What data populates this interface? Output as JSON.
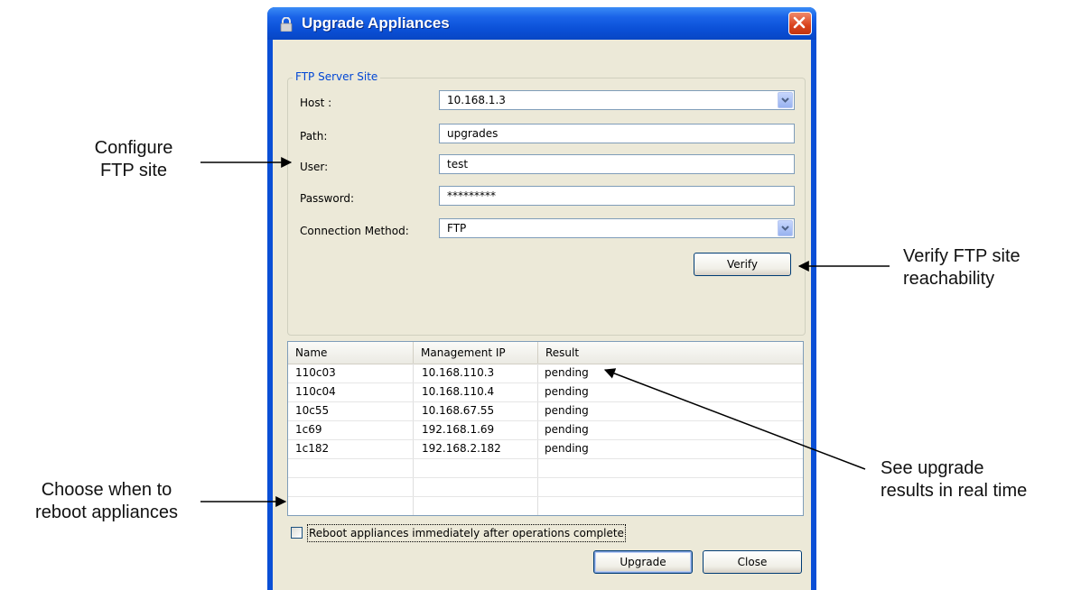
{
  "annotations": {
    "configure": [
      "Configure",
      "FTP site"
    ],
    "verify": [
      "Verify FTP site",
      "reachability"
    ],
    "results": [
      "See upgrade",
      "results in real time"
    ],
    "reboot": [
      "Choose when to",
      "reboot appliances"
    ]
  },
  "dialog": {
    "title": "Upgrade Appliances",
    "group_title": "FTP Server Site",
    "fields": {
      "host_label": "Host :",
      "host_value": "10.168.1.3",
      "path_label": "Path:",
      "path_value": "upgrades",
      "user_label": "User:",
      "user_value": "test",
      "password_label": "Password:",
      "password_value": "*********",
      "method_label": "Connection Method:",
      "method_value": "FTP"
    },
    "verify_button": "Verify",
    "table": {
      "columns": [
        "Name",
        "Management IP",
        "Result"
      ],
      "rows": [
        [
          "110c03",
          "10.168.110.3",
          "pending"
        ],
        [
          "110c04",
          "10.168.110.4",
          "pending"
        ],
        [
          "10c55",
          "10.168.67.55",
          "pending"
        ],
        [
          "1c69",
          "192.168.1.69",
          "pending"
        ],
        [
          "1c182",
          "192.168.2.182",
          "pending"
        ]
      ]
    },
    "reboot_checkbox": {
      "label": "Reboot appliances immediately after operations complete",
      "checked": false
    },
    "upgrade_button": "Upgrade",
    "close_button": "Close"
  }
}
